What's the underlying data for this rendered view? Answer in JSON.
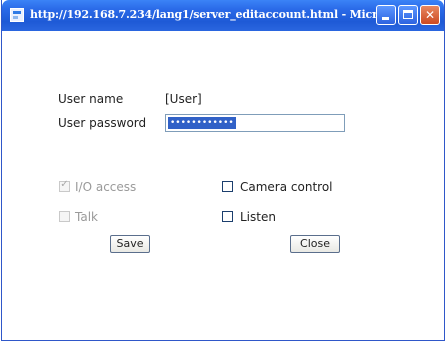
{
  "window": {
    "title": "http://192.168.7.234/lang1/server_editaccount.html - Micr..."
  },
  "form": {
    "user_name_label": "User name",
    "user_name_value": "[User]",
    "password_label": "User password",
    "password_value": "••••••••••••",
    "checkboxes": [
      {
        "label": "I/O access",
        "checked": true,
        "disabled": true
      },
      {
        "label": "Camera control",
        "checked": false,
        "disabled": false
      },
      {
        "label": "Talk",
        "checked": false,
        "disabled": true
      },
      {
        "label": "Listen",
        "checked": false,
        "disabled": false
      }
    ]
  },
  "buttons": {
    "save_label": "Save",
    "close_label": "Close"
  },
  "titlebar_icons": [
    "ie-page-icon",
    "minimize-icon",
    "maximize-icon",
    "close-icon"
  ],
  "colors": {
    "titlebar": "#2a6ae8",
    "close_button": "#cc4a22",
    "selection": "#3161c7"
  }
}
